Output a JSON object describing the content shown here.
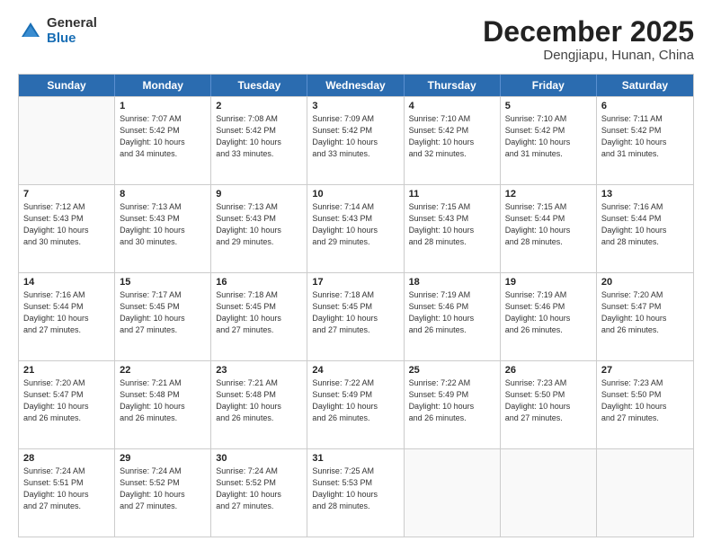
{
  "logo": {
    "general": "General",
    "blue": "Blue"
  },
  "title": "December 2025",
  "location": "Dengjiapu, Hunan, China",
  "days": [
    "Sunday",
    "Monday",
    "Tuesday",
    "Wednesday",
    "Thursday",
    "Friday",
    "Saturday"
  ],
  "rows": [
    [
      {
        "day": "",
        "info": ""
      },
      {
        "day": "1",
        "info": "Sunrise: 7:07 AM\nSunset: 5:42 PM\nDaylight: 10 hours\nand 34 minutes."
      },
      {
        "day": "2",
        "info": "Sunrise: 7:08 AM\nSunset: 5:42 PM\nDaylight: 10 hours\nand 33 minutes."
      },
      {
        "day": "3",
        "info": "Sunrise: 7:09 AM\nSunset: 5:42 PM\nDaylight: 10 hours\nand 33 minutes."
      },
      {
        "day": "4",
        "info": "Sunrise: 7:10 AM\nSunset: 5:42 PM\nDaylight: 10 hours\nand 32 minutes."
      },
      {
        "day": "5",
        "info": "Sunrise: 7:10 AM\nSunset: 5:42 PM\nDaylight: 10 hours\nand 31 minutes."
      },
      {
        "day": "6",
        "info": "Sunrise: 7:11 AM\nSunset: 5:42 PM\nDaylight: 10 hours\nand 31 minutes."
      }
    ],
    [
      {
        "day": "7",
        "info": "Sunrise: 7:12 AM\nSunset: 5:43 PM\nDaylight: 10 hours\nand 30 minutes."
      },
      {
        "day": "8",
        "info": "Sunrise: 7:13 AM\nSunset: 5:43 PM\nDaylight: 10 hours\nand 30 minutes."
      },
      {
        "day": "9",
        "info": "Sunrise: 7:13 AM\nSunset: 5:43 PM\nDaylight: 10 hours\nand 29 minutes."
      },
      {
        "day": "10",
        "info": "Sunrise: 7:14 AM\nSunset: 5:43 PM\nDaylight: 10 hours\nand 29 minutes."
      },
      {
        "day": "11",
        "info": "Sunrise: 7:15 AM\nSunset: 5:43 PM\nDaylight: 10 hours\nand 28 minutes."
      },
      {
        "day": "12",
        "info": "Sunrise: 7:15 AM\nSunset: 5:44 PM\nDaylight: 10 hours\nand 28 minutes."
      },
      {
        "day": "13",
        "info": "Sunrise: 7:16 AM\nSunset: 5:44 PM\nDaylight: 10 hours\nand 28 minutes."
      }
    ],
    [
      {
        "day": "14",
        "info": "Sunrise: 7:16 AM\nSunset: 5:44 PM\nDaylight: 10 hours\nand 27 minutes."
      },
      {
        "day": "15",
        "info": "Sunrise: 7:17 AM\nSunset: 5:45 PM\nDaylight: 10 hours\nand 27 minutes."
      },
      {
        "day": "16",
        "info": "Sunrise: 7:18 AM\nSunset: 5:45 PM\nDaylight: 10 hours\nand 27 minutes."
      },
      {
        "day": "17",
        "info": "Sunrise: 7:18 AM\nSunset: 5:45 PM\nDaylight: 10 hours\nand 27 minutes."
      },
      {
        "day": "18",
        "info": "Sunrise: 7:19 AM\nSunset: 5:46 PM\nDaylight: 10 hours\nand 26 minutes."
      },
      {
        "day": "19",
        "info": "Sunrise: 7:19 AM\nSunset: 5:46 PM\nDaylight: 10 hours\nand 26 minutes."
      },
      {
        "day": "20",
        "info": "Sunrise: 7:20 AM\nSunset: 5:47 PM\nDaylight: 10 hours\nand 26 minutes."
      }
    ],
    [
      {
        "day": "21",
        "info": "Sunrise: 7:20 AM\nSunset: 5:47 PM\nDaylight: 10 hours\nand 26 minutes."
      },
      {
        "day": "22",
        "info": "Sunrise: 7:21 AM\nSunset: 5:48 PM\nDaylight: 10 hours\nand 26 minutes."
      },
      {
        "day": "23",
        "info": "Sunrise: 7:21 AM\nSunset: 5:48 PM\nDaylight: 10 hours\nand 26 minutes."
      },
      {
        "day": "24",
        "info": "Sunrise: 7:22 AM\nSunset: 5:49 PM\nDaylight: 10 hours\nand 26 minutes."
      },
      {
        "day": "25",
        "info": "Sunrise: 7:22 AM\nSunset: 5:49 PM\nDaylight: 10 hours\nand 26 minutes."
      },
      {
        "day": "26",
        "info": "Sunrise: 7:23 AM\nSunset: 5:50 PM\nDaylight: 10 hours\nand 27 minutes."
      },
      {
        "day": "27",
        "info": "Sunrise: 7:23 AM\nSunset: 5:50 PM\nDaylight: 10 hours\nand 27 minutes."
      }
    ],
    [
      {
        "day": "28",
        "info": "Sunrise: 7:24 AM\nSunset: 5:51 PM\nDaylight: 10 hours\nand 27 minutes."
      },
      {
        "day": "29",
        "info": "Sunrise: 7:24 AM\nSunset: 5:52 PM\nDaylight: 10 hours\nand 27 minutes."
      },
      {
        "day": "30",
        "info": "Sunrise: 7:24 AM\nSunset: 5:52 PM\nDaylight: 10 hours\nand 27 minutes."
      },
      {
        "day": "31",
        "info": "Sunrise: 7:25 AM\nSunset: 5:53 PM\nDaylight: 10 hours\nand 28 minutes."
      },
      {
        "day": "",
        "info": ""
      },
      {
        "day": "",
        "info": ""
      },
      {
        "day": "",
        "info": ""
      }
    ]
  ]
}
